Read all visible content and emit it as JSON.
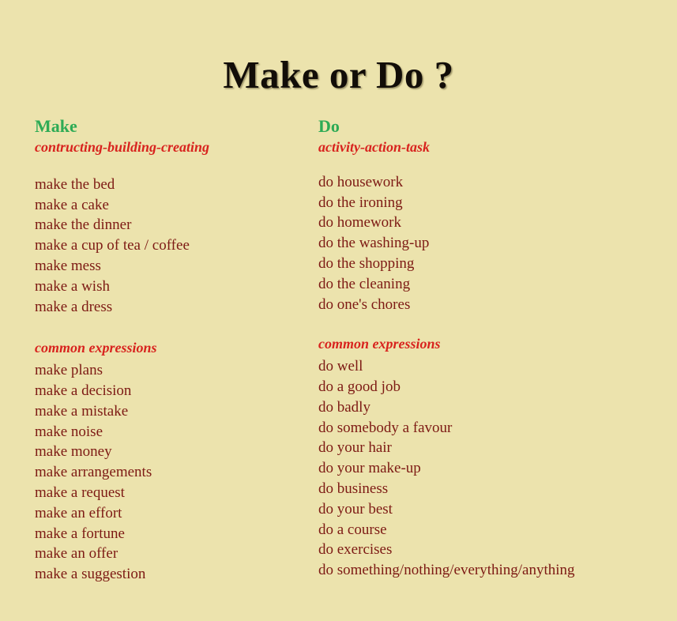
{
  "title": "Make or Do ?",
  "colors": {
    "background": "#ece3ad",
    "title": "#120d08",
    "heading_green": "#2eab55",
    "subheading_red": "#d8231e",
    "list_maroon": "#7d1a14"
  },
  "columns": [
    {
      "heading": "Make",
      "subheading": "contructing-building-creating",
      "items": [
        "make the bed",
        "make a cake",
        "make the dinner",
        "make a cup of tea / coffee",
        "make mess",
        "make a wish",
        "make a dress"
      ],
      "group_label": "common expressions",
      "group_items": [
        "make plans",
        "make a decision",
        "make a mistake",
        "make noise",
        "make money",
        "make arrangements",
        "make a request",
        "make an effort",
        "make a fortune",
        "make an offer",
        "make a suggestion"
      ]
    },
    {
      "heading": "Do",
      "subheading": "activity-action-task",
      "items": [
        "do housework",
        "do the ironing",
        "do homework",
        "do the washing-up",
        "do the shopping",
        "do the cleaning",
        "do one's chores"
      ],
      "group_label": "common expressions",
      "group_items": [
        "do well",
        "do a good job",
        "do badly",
        "do somebody a favour",
        "do your hair",
        "do your make-up",
        "do business",
        "do your best",
        "do a course",
        "do exercises",
        "do something/nothing/everything/anything"
      ]
    }
  ]
}
